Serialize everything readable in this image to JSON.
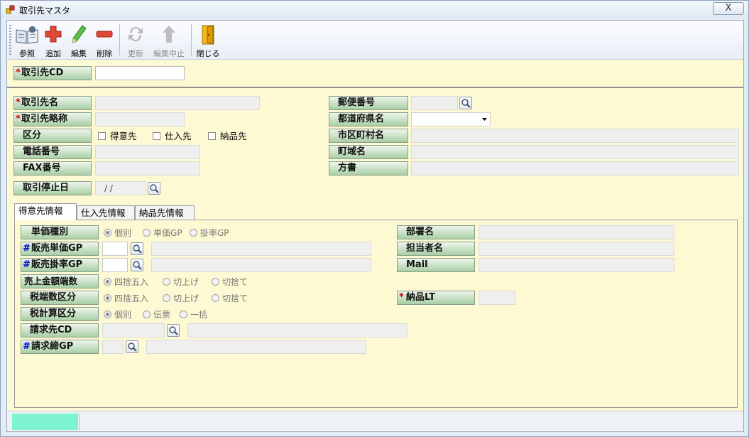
{
  "window": {
    "title": "取引先マスタ",
    "close": "X"
  },
  "toolbar": [
    {
      "label": "参照",
      "icon": "reference-icon",
      "enabled": true
    },
    {
      "label": "追加",
      "icon": "add-icon",
      "enabled": true
    },
    {
      "label": "編集",
      "icon": "edit-pencil-icon",
      "enabled": true
    },
    {
      "label": "削除",
      "icon": "delete-icon",
      "enabled": true
    },
    {
      "label": "更新",
      "icon": "refresh-icon",
      "enabled": false
    },
    {
      "label": "編集中止",
      "icon": "undo-icon",
      "enabled": false
    },
    {
      "label": "閉じる",
      "icon": "close-door-icon",
      "enabled": true
    }
  ],
  "header": {
    "code_label": "取引先CD",
    "code_value": ""
  },
  "form": {
    "name_label": "取引先名",
    "short_name_label": "取引先略称",
    "category_label": "区分",
    "category_options": [
      "得意先",
      "仕入先",
      "納品先"
    ],
    "phone_label": "電話番号",
    "fax_label": "FAX番号",
    "stop_date_label": "取引停止日",
    "stop_date_value": "/ /",
    "postal_label": "郵便番号",
    "prefecture_label": "都道府県名",
    "city_label": "市区町村名",
    "town_label": "町域名",
    "address_extra_label": "方書"
  },
  "tabs": [
    "得意先情報",
    "仕入先情報",
    "納品先情報"
  ],
  "customer": {
    "price_type_label": "単価種別",
    "price_type_options": [
      "個別",
      "単価GP",
      "掛率GP"
    ],
    "sales_price_gp_label": "販売単価GP",
    "sales_rate_gp_label": "販売掛率GP",
    "sales_rounding_label": "売上金額端数",
    "sales_rounding_options": [
      "四捨五入",
      "切上げ",
      "切捨て"
    ],
    "tax_rounding_label": "税端数区分",
    "tax_rounding_options": [
      "四捨五入",
      "切上げ",
      "切捨て"
    ],
    "tax_calc_label": "税計算区分",
    "tax_calc_options": [
      "個別",
      "伝票",
      "一括"
    ],
    "billing_cd_label": "請求先CD",
    "billing_close_gp_label": "請求締GP",
    "dept_label": "部署名",
    "person_label": "担当者名",
    "mail_label": "Mail",
    "delivery_lt_label": "納品LT"
  },
  "colors": {
    "form_bg": "#fdf9d3",
    "label_green": "#a8cfa5",
    "required_mark": "#d40000",
    "group_mark": "#0000c8",
    "status_cell": "#7df4cf"
  }
}
